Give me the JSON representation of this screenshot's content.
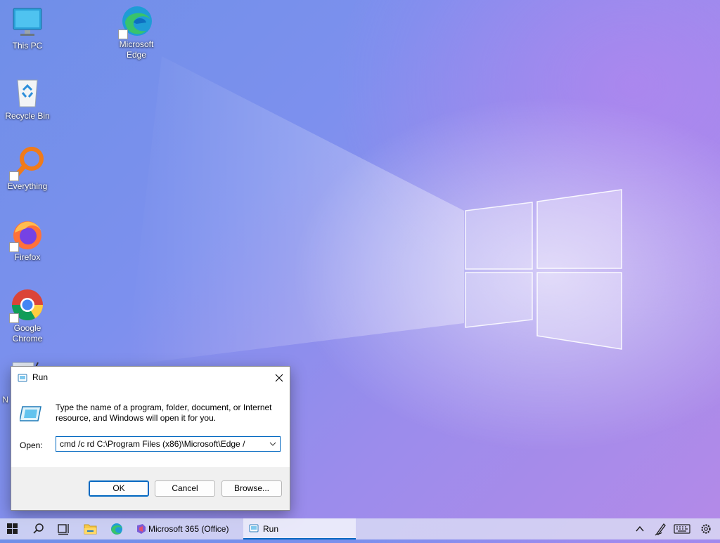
{
  "desktop": {
    "icons": [
      {
        "label": "This PC",
        "icon": "this-pc-icon"
      },
      {
        "label": "Microsoft Edge",
        "icon": "edge-icon"
      },
      {
        "label": "Recycle Bin",
        "icon": "recycle-bin-icon"
      },
      {
        "label": "Everything",
        "icon": "everything-search-icon"
      },
      {
        "label": "Firefox",
        "icon": "firefox-icon"
      },
      {
        "label": "Google Chrome",
        "icon": "chrome-icon"
      },
      {
        "label": "N",
        "icon": "notepad-icon"
      }
    ]
  },
  "run_dialog": {
    "title": "Run",
    "description": "Type the name of a program, folder, document, or Internet resource, and Windows will open it for you.",
    "open_label": "Open:",
    "open_value": "cmd /c rd C:\\Program Files (x86)\\Microsoft\\Edge /",
    "ok_label": "OK",
    "cancel_label": "Cancel",
    "browse_label": "Browse..."
  },
  "taskbar": {
    "tasks": [
      {
        "label": "Microsoft 365 (Office)",
        "icon": "office-icon",
        "active": false
      },
      {
        "label": "Run",
        "icon": "run-icon",
        "active": true
      }
    ],
    "pinned": [
      "start-icon",
      "search-icon",
      "task-view-icon",
      "file-explorer-icon",
      "edge-icon"
    ],
    "tray": [
      "chevron-up-icon",
      "pen-icon",
      "keyboard-icon",
      "settings-gear-icon"
    ]
  },
  "colors": {
    "accent": "#0067c0",
    "dialog_bg": "#f0f0f0"
  }
}
